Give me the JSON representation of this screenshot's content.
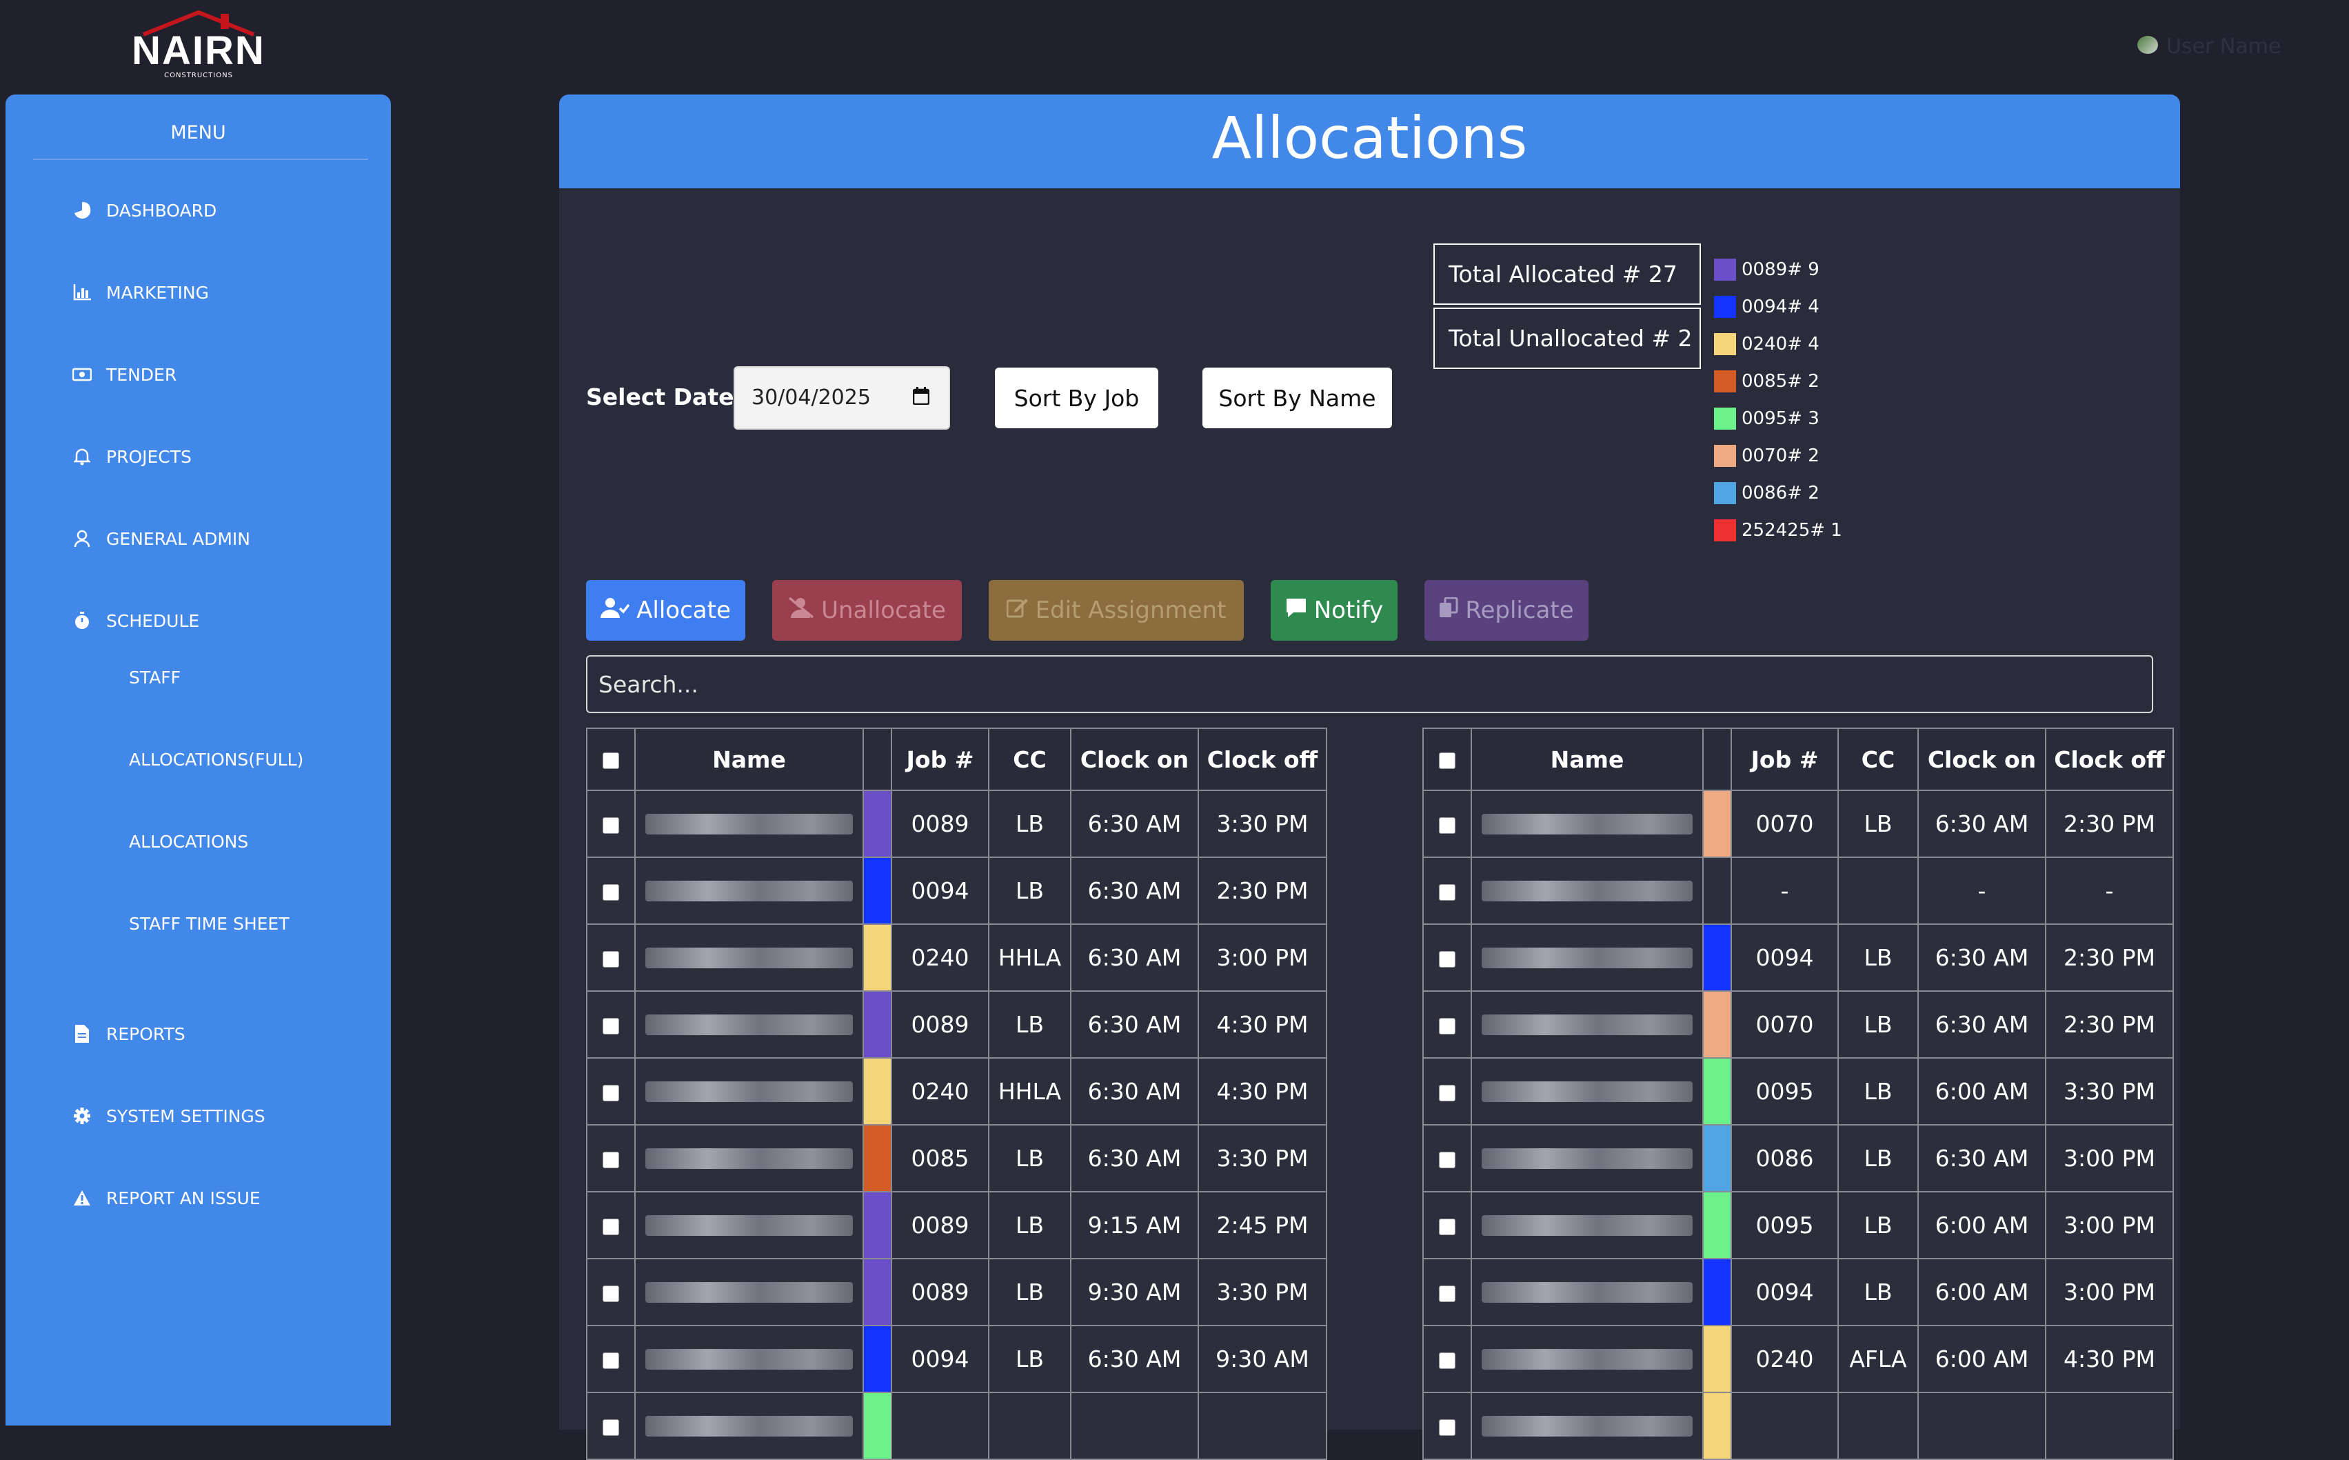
{
  "brand": {
    "logo_text": "NAIRN",
    "logo_sub": "CONSTRUCTIONS"
  },
  "user": {
    "name": "User Name"
  },
  "sidebar": {
    "menu_title": "MENU",
    "items": [
      {
        "label": "DASHBOARD",
        "icon": "pie-chart-icon"
      },
      {
        "label": "MARKETING",
        "icon": "bar-chart-icon"
      },
      {
        "label": "TENDER",
        "icon": "money-icon"
      },
      {
        "label": "PROJECTS",
        "icon": "bell-icon"
      },
      {
        "label": "GENERAL ADMIN",
        "icon": "user-icon"
      },
      {
        "label": "SCHEDULE",
        "icon": "stopwatch-icon"
      }
    ],
    "schedule_sub": [
      "STAFF",
      "ALLOCATIONS(FULL)",
      "ALLOCATIONS",
      "STAFF TIME SHEET"
    ],
    "bottom_items": [
      {
        "label": "REPORTS",
        "icon": "file-icon"
      },
      {
        "label": "SYSTEM SETTINGS",
        "icon": "gear-icon"
      },
      {
        "label": "REPORT AN ISSUE",
        "icon": "warning-icon"
      }
    ]
  },
  "page": {
    "title": "Allocations",
    "select_date_label": "Select Date:",
    "date_value": "30/04/2025",
    "sort_by_job": "Sort By Job",
    "sort_by_name": "Sort By Name",
    "total_allocated": "Total Allocated # 27",
    "total_unallocated": "Total Unallocated # 2",
    "search_placeholder": "Search..."
  },
  "legend": [
    {
      "label": "0089# 9",
      "color": "#6a4fc8"
    },
    {
      "label": "0094# 4",
      "color": "#1334ff"
    },
    {
      "label": "0240# 4",
      "color": "#f4d57a"
    },
    {
      "label": "0085# 2",
      "color": "#d65c25"
    },
    {
      "label": "0095# 3",
      "color": "#6ef08a"
    },
    {
      "label": "0070# 2",
      "color": "#eeab83"
    },
    {
      "label": "0086# 2",
      "color": "#4fa6e3"
    },
    {
      "label": "252425# 1",
      "color": "#ef3030"
    }
  ],
  "actions": {
    "allocate": "Allocate",
    "unallocate": "Unallocate",
    "edit": "Edit Assignment",
    "notify": "Notify",
    "replicate": "Replicate"
  },
  "columns": [
    "Name",
    "Job #",
    "CC",
    "Clock on",
    "Clock off"
  ],
  "left_rows": [
    {
      "color": "#6a4fc8",
      "job": "0089",
      "cc": "LB",
      "on": "6:30 AM",
      "off": "3:30 PM"
    },
    {
      "color": "#1334ff",
      "job": "0094",
      "cc": "LB",
      "on": "6:30 AM",
      "off": "2:30 PM"
    },
    {
      "color": "#f4d57a",
      "job": "0240",
      "cc": "HHLA",
      "on": "6:30 AM",
      "off": "3:00 PM"
    },
    {
      "color": "#6a4fc8",
      "job": "0089",
      "cc": "LB",
      "on": "6:30 AM",
      "off": "4:30 PM"
    },
    {
      "color": "#f4d57a",
      "job": "0240",
      "cc": "HHLA",
      "on": "6:30 AM",
      "off": "4:30 PM"
    },
    {
      "color": "#d65c25",
      "job": "0085",
      "cc": "LB",
      "on": "6:30 AM",
      "off": "3:30 PM"
    },
    {
      "color": "#6a4fc8",
      "job": "0089",
      "cc": "LB",
      "on": "9:15 AM",
      "off": "2:45 PM"
    },
    {
      "color": "#6a4fc8",
      "job": "0089",
      "cc": "LB",
      "on": "9:30 AM",
      "off": "3:30 PM"
    },
    {
      "color": "#1334ff",
      "job": "0094",
      "cc": "LB",
      "on": "6:30 AM",
      "off": "9:30 AM"
    },
    {
      "color": "#6ef08a",
      "job": "",
      "cc": "",
      "on": "",
      "off": ""
    }
  ],
  "right_rows": [
    {
      "color": "#eeab83",
      "job": "0070",
      "cc": "LB",
      "on": "6:30 AM",
      "off": "2:30 PM"
    },
    {
      "color": "#2d2e3c",
      "job": "-",
      "cc": "",
      "on": "-",
      "off": "-"
    },
    {
      "color": "#1334ff",
      "job": "0094",
      "cc": "LB",
      "on": "6:30 AM",
      "off": "2:30 PM"
    },
    {
      "color": "#eeab83",
      "job": "0070",
      "cc": "LB",
      "on": "6:30 AM",
      "off": "2:30 PM"
    },
    {
      "color": "#6ef08a",
      "job": "0095",
      "cc": "LB",
      "on": "6:00 AM",
      "off": "3:30 PM"
    },
    {
      "color": "#4fa6e3",
      "job": "0086",
      "cc": "LB",
      "on": "6:30 AM",
      "off": "3:00 PM"
    },
    {
      "color": "#6ef08a",
      "job": "0095",
      "cc": "LB",
      "on": "6:00 AM",
      "off": "3:00 PM"
    },
    {
      "color": "#1334ff",
      "job": "0094",
      "cc": "LB",
      "on": "6:00 AM",
      "off": "3:00 PM"
    },
    {
      "color": "#f4d57a",
      "job": "0240",
      "cc": "AFLA",
      "on": "6:00 AM",
      "off": "4:30 PM"
    },
    {
      "color": "#f4d57a",
      "job": "",
      "cc": "",
      "on": "",
      "off": ""
    }
  ]
}
